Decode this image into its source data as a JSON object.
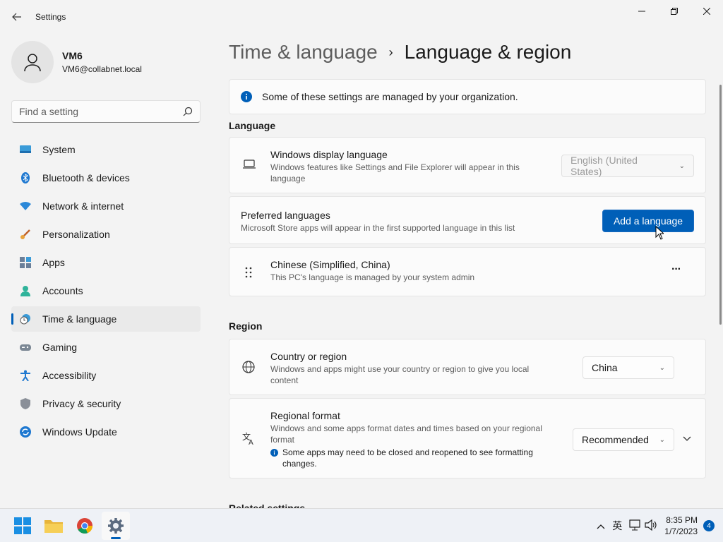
{
  "window": {
    "title": "Settings"
  },
  "profile": {
    "name": "VM6",
    "email": "VM6@collabnet.local"
  },
  "search": {
    "placeholder": "Find a setting"
  },
  "sidebar": {
    "items": [
      {
        "label": "System",
        "icon": "system-icon"
      },
      {
        "label": "Bluetooth & devices",
        "icon": "bluetooth-icon"
      },
      {
        "label": "Network & internet",
        "icon": "wifi-icon"
      },
      {
        "label": "Personalization",
        "icon": "brush-icon"
      },
      {
        "label": "Apps",
        "icon": "apps-icon"
      },
      {
        "label": "Accounts",
        "icon": "person-icon"
      },
      {
        "label": "Time & language",
        "icon": "clock-globe-icon",
        "active": true
      },
      {
        "label": "Gaming",
        "icon": "gamepad-icon"
      },
      {
        "label": "Accessibility",
        "icon": "accessibility-icon"
      },
      {
        "label": "Privacy & security",
        "icon": "shield-icon"
      },
      {
        "label": "Windows Update",
        "icon": "update-icon"
      }
    ]
  },
  "breadcrumb": {
    "parent": "Time & language",
    "separator": "›",
    "current": "Language & region"
  },
  "info_bar": {
    "text": "Some of these settings are managed by your organization."
  },
  "language": {
    "section_title": "Language",
    "display_language": {
      "title": "Windows display language",
      "desc": "Windows features like Settings and File Explorer will appear in this language",
      "value": "English (United States)"
    },
    "preferred": {
      "title": "Preferred languages",
      "desc": "Microsoft Store apps will appear in the first supported language in this list",
      "button": "Add a language"
    },
    "installed": {
      "title": "Chinese (Simplified, China)",
      "desc": "This PC's language is managed by your system admin",
      "more": "···"
    }
  },
  "region": {
    "section_title": "Region",
    "country": {
      "title": "Country or region",
      "desc": "Windows and apps might use your country or region to give you local content",
      "value": "China"
    },
    "format": {
      "title": "Regional format",
      "desc": "Windows and some apps format dates and times based on your regional format",
      "note": "Some apps may need to be closed and reopened to see formatting changes.",
      "value": "Recommended"
    }
  },
  "related": {
    "section_title": "Related settings"
  },
  "taskbar": {
    "ime": "英",
    "time": "8:35 PM",
    "date": "1/7/2023",
    "notifications": "4"
  },
  "colors": {
    "accent": "#005fb8",
    "background": "#f3f3f3",
    "card": "#fbfbfb"
  }
}
